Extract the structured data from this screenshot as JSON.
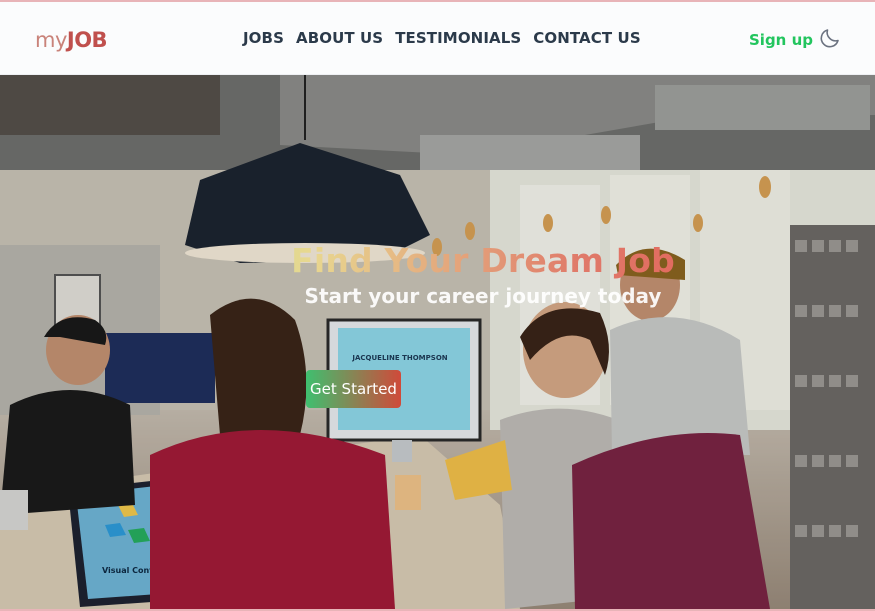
{
  "header": {
    "logo_prefix": "my",
    "logo_main": "JOB",
    "nav": [
      {
        "label": "JOBS"
      },
      {
        "label": "ABOUT US"
      },
      {
        "label": "TESTIMONIALS"
      },
      {
        "label": "CONTACT US"
      }
    ],
    "signup_label": "Sign up",
    "theme_icon": "moon-icon"
  },
  "hero": {
    "title": "Find Your Dream Job",
    "subtitle": "Start your career journey today",
    "cta_label": "Get Started",
    "image_description_icon": "office-photo",
    "monitor_name": "JACQUELINE THOMPSON",
    "laptop_caption": "Visual Content"
  },
  "colors": {
    "accent_green": "#22c55e",
    "logo_red": "#c0504d",
    "nav_text": "#2b3a4a",
    "cta_gradient_start": "#3fbf6f",
    "cta_gradient_end": "#d04a3a"
  }
}
